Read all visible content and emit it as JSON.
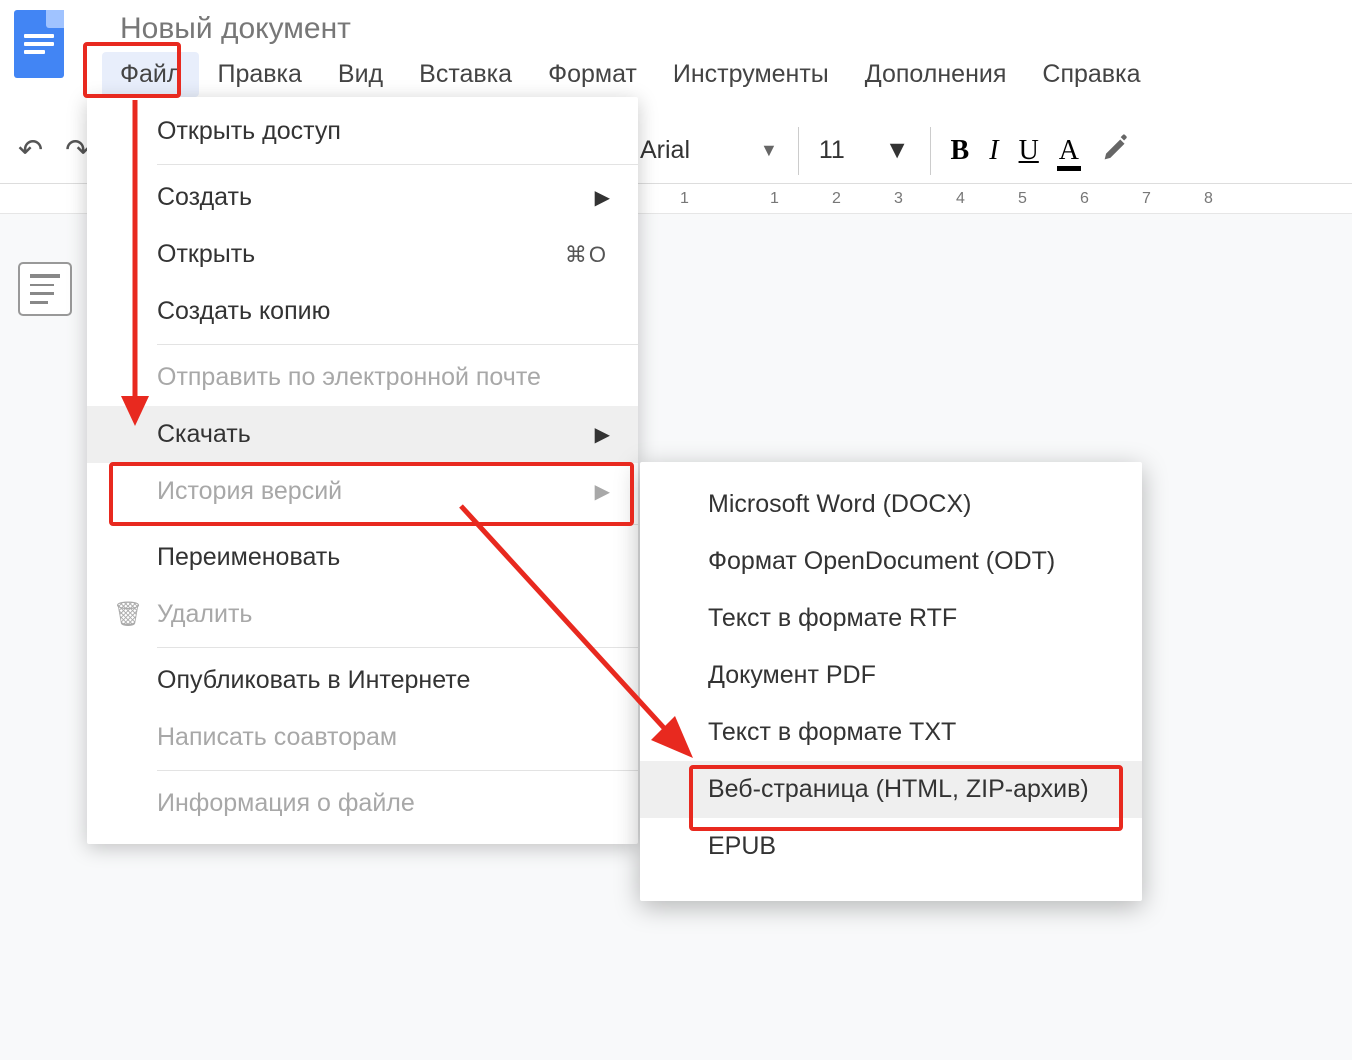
{
  "doc_title": "Новый документ",
  "menubar": {
    "file": "Файл",
    "edit": "Правка",
    "view": "Вид",
    "insert": "Вставка",
    "format": "Формат",
    "tools": "Инструменты",
    "addons": "Дополнения",
    "help": "Справка"
  },
  "toolbar": {
    "font_name": "Arial",
    "font_size": "11",
    "bold": "B",
    "italic": "I",
    "underline": "U",
    "text_color_glyph": "A"
  },
  "ruler_labels": [
    "1",
    "1",
    "2",
    "3",
    "4",
    "5",
    "6",
    "7",
    "8"
  ],
  "file_menu": {
    "share": "Открыть доступ",
    "create": "Создать",
    "open": "Открыть",
    "open_shortcut": "⌘O",
    "make_copy": "Создать копию",
    "email": "Отправить по электронной почте",
    "download": "Скачать",
    "version_history": "История версий",
    "rename": "Переименовать",
    "delete": "Удалить",
    "publish": "Опубликовать в Интернете",
    "email_collaborators": "Написать соавторам",
    "file_info": "Информация о файле"
  },
  "download_submenu": {
    "docx": "Microsoft Word (DOCX)",
    "odt": "Формат OpenDocument (ODT)",
    "rtf": "Текст в формате RTF",
    "pdf": "Документ PDF",
    "txt": "Текст в формате TXT",
    "html": "Веб-страница (HTML, ZIP-архив)",
    "epub": "EPUB"
  }
}
